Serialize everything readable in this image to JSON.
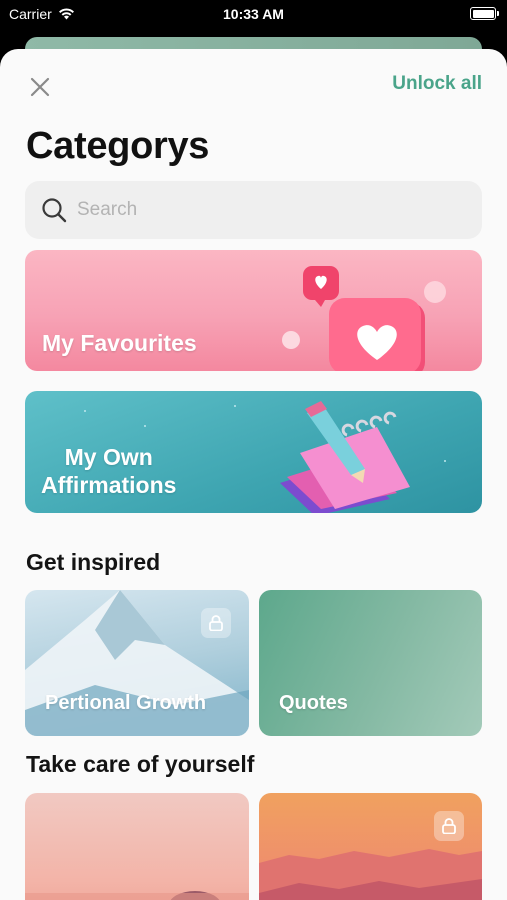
{
  "status_bar": {
    "carrier": "Carrier",
    "time": "10:33 AM"
  },
  "header": {
    "close_icon": "close-icon",
    "unlock_label": "Unlock all",
    "title": "Categorys"
  },
  "search": {
    "placeholder": "Search",
    "value": ""
  },
  "featured": [
    {
      "label": "My Favourites"
    },
    {
      "label": "My Own\nAffirmations"
    }
  ],
  "sections": [
    {
      "title": "Get inspired",
      "cards": [
        {
          "label": "Pertional Growth",
          "locked": true
        },
        {
          "label": "Quotes",
          "locked": false
        }
      ]
    },
    {
      "title": "Take care of yourself",
      "cards": [
        {
          "label": "",
          "locked": false
        },
        {
          "label": "",
          "locked": true
        }
      ]
    }
  ],
  "colors": {
    "accent": "#4aa48a",
    "background": "#fafafa",
    "search_bg": "#efefef"
  }
}
